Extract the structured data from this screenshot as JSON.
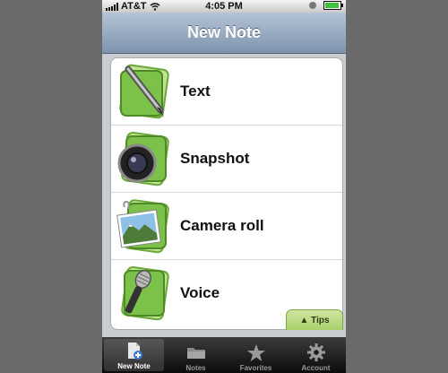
{
  "status_bar": {
    "carrier": "AT&T",
    "time": "4:05 PM"
  },
  "nav": {
    "title": "New Note"
  },
  "list": [
    {
      "label": "Text",
      "icon": "pen-icon"
    },
    {
      "label": "Snapshot",
      "icon": "camera-icon"
    },
    {
      "label": "Camera roll",
      "icon": "photo-icon"
    },
    {
      "label": "Voice",
      "icon": "microphone-icon"
    }
  ],
  "tips": {
    "label": "▲ Tips"
  },
  "tabbar": {
    "tabs": [
      {
        "label": "New Note",
        "icon": "new-note-icon",
        "active": true
      },
      {
        "label": "Notes",
        "icon": "folder-icon"
      },
      {
        "label": "Favorites",
        "icon": "star-icon"
      },
      {
        "label": "Account",
        "icon": "gear-icon"
      }
    ]
  },
  "colors": {
    "nav": "#7d93ad",
    "accent_green": "#7cc14a",
    "tabbar": "#1a1a1a"
  }
}
